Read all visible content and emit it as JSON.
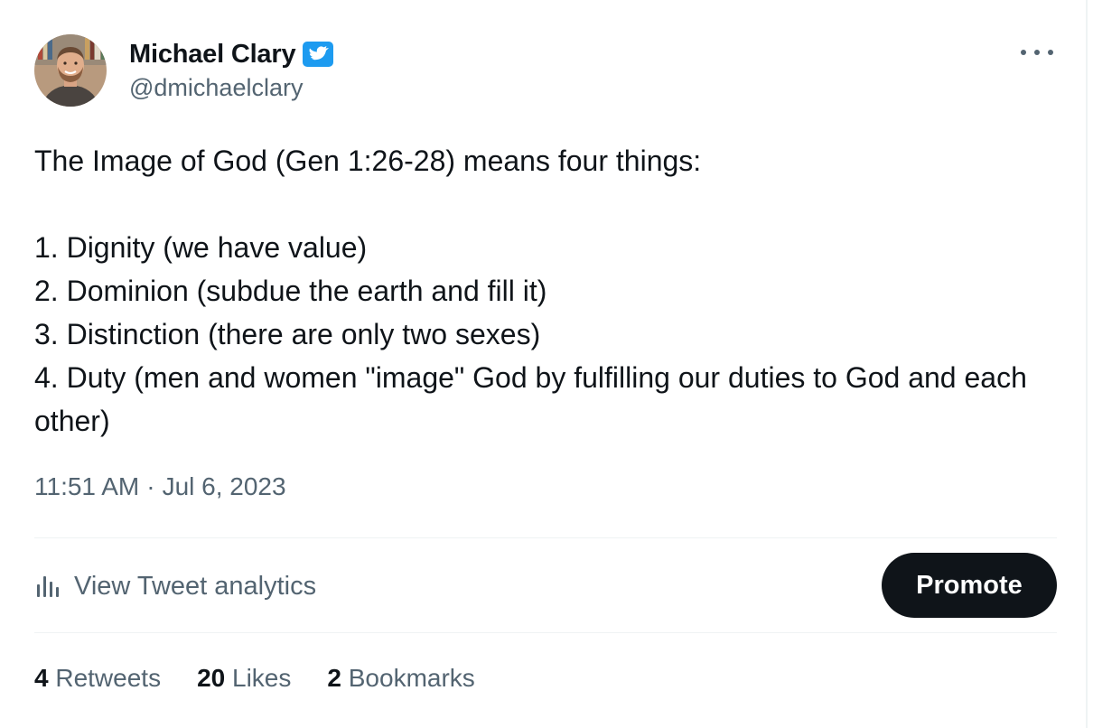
{
  "author": {
    "display_name": "Michael Clary",
    "handle": "@dmichaelclary",
    "verified": true,
    "avatar_icon": "avatar-photo"
  },
  "tweet": {
    "lines": [
      "The Image of God (Gen 1:26-28) means four things:",
      "",
      "1. Dignity (we have value)",
      "2. Dominion (subdue the earth and fill it)",
      "3. Distinction (there are only two sexes)",
      "4. Duty (men and women \"image\" God by fulfilling our duties to God and each other)"
    ]
  },
  "meta": {
    "time": "11:51 AM",
    "separator": "·",
    "date": "Jul 6, 2023"
  },
  "actions": {
    "analytics_label": "View Tweet analytics",
    "analytics_icon": "bar-chart-icon",
    "promote_label": "Promote",
    "more_icon": "more-horizontal-icon"
  },
  "stats": [
    {
      "count": "4",
      "label": "Retweets"
    },
    {
      "count": "20",
      "label": "Likes"
    },
    {
      "count": "2",
      "label": "Bookmarks"
    }
  ],
  "colors": {
    "text_primary": "#0f1419",
    "text_secondary": "#536471",
    "verified_blue": "#1d9bf0",
    "divider": "#eff3f4",
    "promote_bg": "#0f1419"
  }
}
